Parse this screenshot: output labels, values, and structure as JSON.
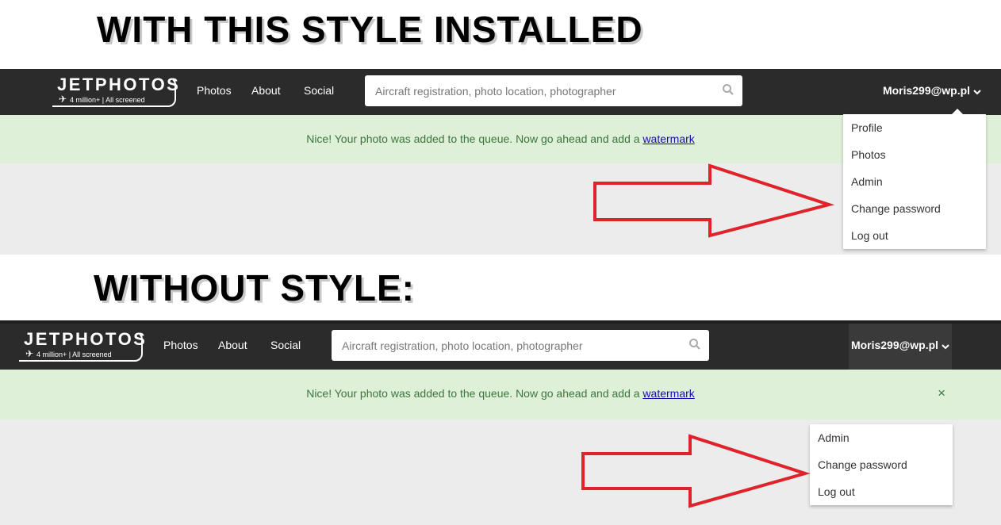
{
  "headings": {
    "with_style": "WITH THIS STYLE INSTALLED",
    "without_style": "WITHOUT STYLE:"
  },
  "site": {
    "logo_text": "JETPHOTOS",
    "logo_sub": "4 million+ | All screened",
    "nav": [
      "Photos",
      "About",
      "Social"
    ],
    "search_placeholder": "Aircraft registration, photo location, photographer",
    "user": "Moris299@wp.pl"
  },
  "alert": {
    "text": "Nice! Your photo was added to the queue. Now go ahead and add a ",
    "link": "watermark",
    "close": "×"
  },
  "dropdown_styled": [
    "Profile",
    "Photos",
    "Admin",
    "Change password",
    "Log out"
  ],
  "dropdown_unstyled": [
    "Admin",
    "Change password",
    "Log out"
  ],
  "colors": {
    "navbar": "#2b2b2b",
    "alert_bg": "#dff0d8",
    "alert_text": "#3c763d",
    "arrow": "#e0232b"
  }
}
